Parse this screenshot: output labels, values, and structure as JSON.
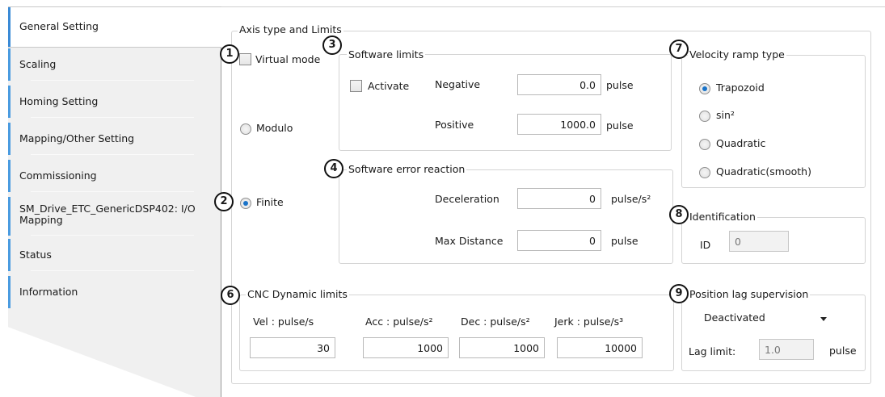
{
  "tabs": [
    {
      "label": "General Setting",
      "active": true
    },
    {
      "label": "Scaling",
      "active": false
    },
    {
      "label": "Homing Setting",
      "active": false
    },
    {
      "label": "Mapping/Other Setting",
      "active": false
    },
    {
      "label": "Commissioning",
      "active": false
    },
    {
      "label": "SM_Drive_ETC_GenericDSP402: I/O\nMapping",
      "active": false
    },
    {
      "label": "Status",
      "active": false
    },
    {
      "label": "Information",
      "active": false
    }
  ],
  "axis": {
    "title": "Axis type and Limits",
    "virtual_mode": "Virtual mode",
    "modulo": "Modulo",
    "finite": "Finite",
    "mode_selected": "Finite"
  },
  "software_limits": {
    "title": "Software limits",
    "activate": "Activate",
    "negative_label": "Negative",
    "negative_value": "0.0",
    "negative_unit": "pulse",
    "positive_label": "Positive",
    "positive_value": "1000.0",
    "positive_unit": "pulse"
  },
  "error_reaction": {
    "title": "Software error reaction",
    "decel_label": "Deceleration",
    "decel_value": "0",
    "decel_unit": "pulse/s²",
    "maxdist_label": "Max Distance",
    "maxdist_value": "0",
    "maxdist_unit": "pulse"
  },
  "cnc": {
    "title": "CNC Dynamic limits",
    "vel_label": "Vel :  pulse/s",
    "vel_value": "30",
    "acc_label": "Acc : pulse/s²",
    "acc_value": "1000",
    "dec_label": "Dec : pulse/s²",
    "dec_value": "1000",
    "jerk_label": "Jerk :  pulse/s³",
    "jerk_value": "10000"
  },
  "velocity_ramp": {
    "title": "Velocity ramp type",
    "options": [
      "Trapozoid",
      "sin²",
      "Quadratic",
      "Quadratic(smooth)"
    ],
    "selected": "Trapozoid"
  },
  "identification": {
    "title": "Identification",
    "id_label": "ID",
    "id_value": "0"
  },
  "lag": {
    "title": "Position lag supervision",
    "mode": "Deactivated",
    "limit_label": "Lag limit:",
    "limit_value": "1.0",
    "limit_unit": "pulse"
  },
  "callouts": [
    "1",
    "2",
    "3",
    "4",
    "6",
    "7",
    "8",
    "9"
  ]
}
